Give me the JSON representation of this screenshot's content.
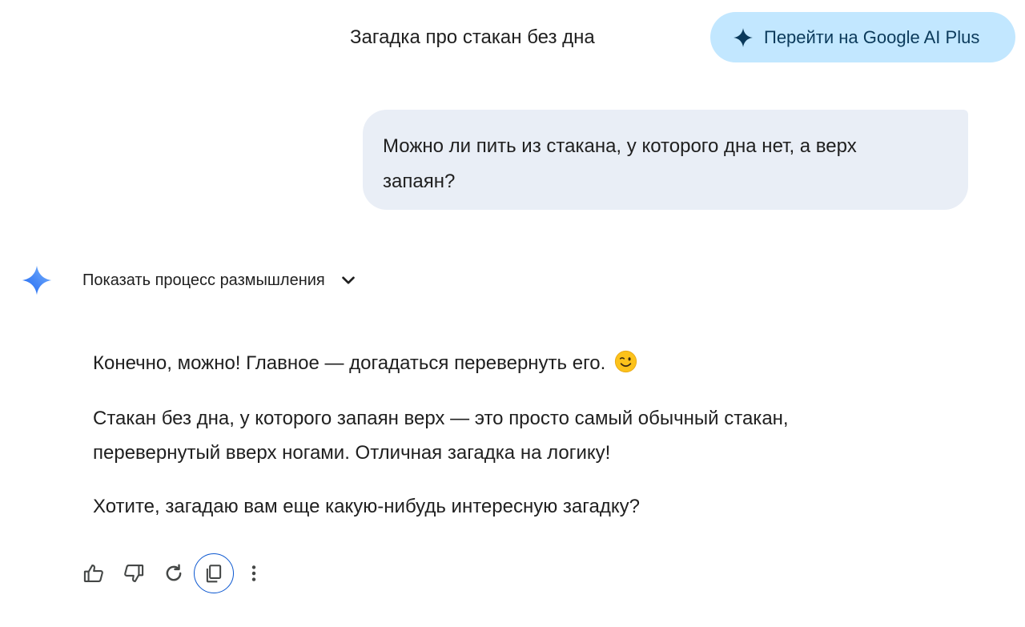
{
  "header": {
    "chat_title": "Загадка про стакан без дна",
    "upgrade_label": "Перейти на Google AI Plus",
    "upgrade_icon": "sparkle-icon"
  },
  "conversation": {
    "user_message": "Можно ли пить из стакана, у которого дна нет, а верх запаян?",
    "assistant": {
      "avatar_icon": "gemini-sparkle-icon",
      "thinking_toggle_label": "Показать процесс размышления",
      "paragraphs": [
        "Конечно, можно! Главное — догадаться перевернуть его.",
        "Стакан без дна, у которого запаян верх — это просто самый обычный стакан, перевернутый вверх ногами. Отличная загадка на логику!",
        "Хотите, загадаю вам еще какую-нибудь интересную загадку?"
      ],
      "emoji": "winking-face-emoji"
    },
    "actions": [
      "thumbs-up-icon",
      "thumbs-down-icon",
      "regenerate-icon",
      "copy-icon",
      "more-options-icon"
    ]
  },
  "colors": {
    "upgrade_bg": "#c2e7ff",
    "upgrade_text": "#0b3a5b",
    "user_bubble_bg": "#e9eef6",
    "focus_ring": "#0b57d0"
  }
}
